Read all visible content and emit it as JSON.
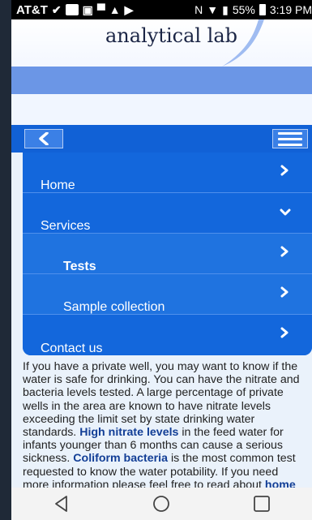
{
  "status_bar": {
    "carrier": "AT&T",
    "nfc": "N",
    "battery_percent": "55%",
    "time": "3:19 PM"
  },
  "header": {
    "logo_text": "analytical lab"
  },
  "nav": {
    "back_icon": "chevron-left-icon",
    "menu_icon": "hamburger-icon",
    "items": [
      {
        "label": "Home",
        "icon": "chevron-right-icon"
      },
      {
        "label": "Services",
        "icon": "chevron-down-icon"
      },
      {
        "label": "Tests",
        "icon": "chevron-right-icon"
      },
      {
        "label": "Sample collection",
        "icon": "chevron-right-icon"
      },
      {
        "label": "Contact us",
        "icon": "chevron-right-icon"
      }
    ]
  },
  "content": {
    "p1": "If you have a private well, you may want to know if the water is safe for drinking. You can have the nitrate and bacteria levels tested. A large percentage of private wells in the area are known to have nitrate levels exceeding the limit set by state drinking water standards.",
    "bold1": "High nitrate levels",
    "p2": "in the feed water for infants younger than 6 months can cause a serious sickness.",
    "bold2": "Coliform bacteria",
    "p3": "is the most common test requested to know the water potability. If you need more information please feel free to read about",
    "bold3": "home"
  },
  "nav_footer": {
    "back_icon": "triangle-back-icon",
    "home_icon": "circle-home-icon",
    "recent_icon": "square-recents-icon"
  }
}
